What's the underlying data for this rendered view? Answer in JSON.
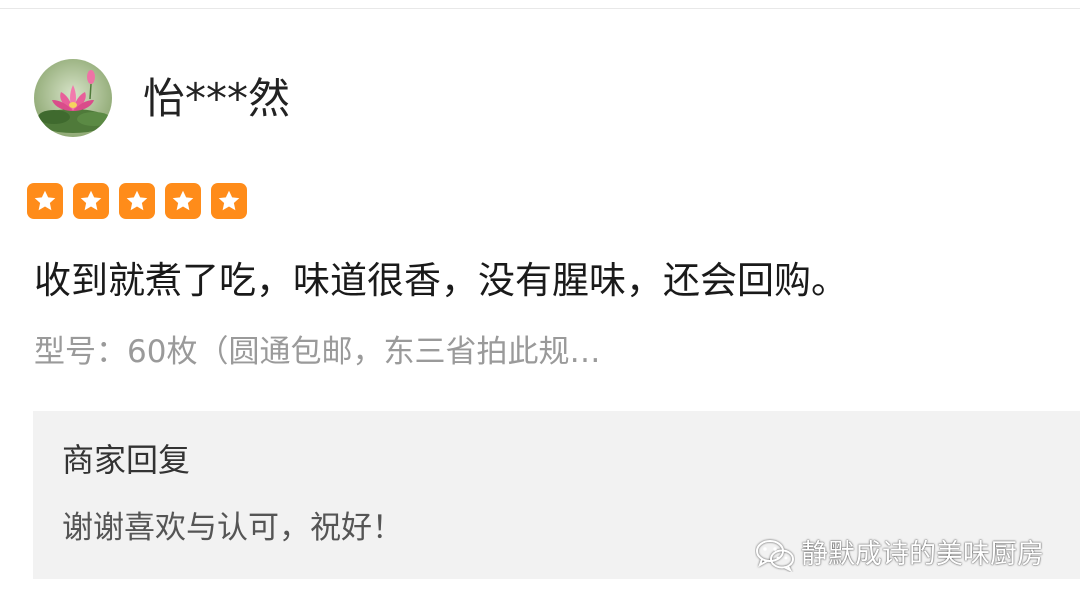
{
  "user": {
    "name": "怡***然",
    "avatar_icon": "lotus-avatar"
  },
  "rating": {
    "stars": 5,
    "max": 5,
    "color": "#ff8c1a"
  },
  "review": {
    "text": "收到就煮了吃，味道很香，没有腥味，还会回购。",
    "model": "型号：60枚（圆通包邮，东三省拍此规…"
  },
  "merchant_reply": {
    "title": "商家回复",
    "text": "谢谢喜欢与认可，祝好！"
  },
  "watermark": {
    "text": "静默成诗的美味厨房",
    "icon": "wechat-icon"
  }
}
